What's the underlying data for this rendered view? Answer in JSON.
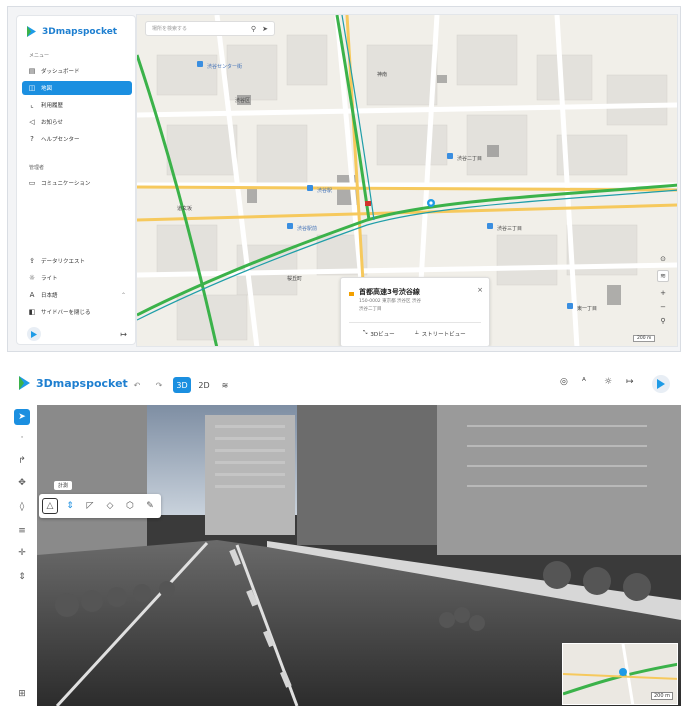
{
  "colors": {
    "brand": "#1e7fd0",
    "active": "#1b8fe0",
    "expressway": "#3bb24a",
    "popup_flag": "#f3a000"
  },
  "app": {
    "name": "3Dmapspocket"
  },
  "sidebar": {
    "section_menu": "メニュー",
    "items": [
      {
        "label": "ダッシュボード",
        "icon": "dashboard-icon"
      },
      {
        "label": "地図",
        "icon": "map-icon",
        "active": true
      },
      {
        "label": "利用履歴",
        "icon": "history-icon"
      },
      {
        "label": "お知らせ",
        "icon": "megaphone-icon"
      },
      {
        "label": "ヘルプセンター",
        "icon": "help-icon"
      }
    ],
    "section_admin": "管理者",
    "admin_items": [
      {
        "label": "コミュニケーション",
        "icon": "chat-icon"
      }
    ],
    "footer_items": [
      {
        "label": "データリクエスト",
        "icon": "upload-icon"
      },
      {
        "label": "ライト",
        "icon": "sun-icon"
      },
      {
        "label": "日本語",
        "icon": "language-icon",
        "has_chevron": true
      },
      {
        "label": "サイドバーを閉じる",
        "icon": "sidebar-icon"
      }
    ]
  },
  "map": {
    "search_placeholder": "場所を検索する",
    "labels": {
      "shibuya_ward": "渋谷区",
      "shibuya_center": "渋谷センター街",
      "shibuya_sta": "渋谷駅",
      "shibuya_sta_b": "渋谷駅前",
      "jinnan": "神南",
      "dogenzaka": "道玄坂",
      "sakuragaoka": "桜丘町",
      "shibuya_2": "渋谷二丁目",
      "shibuya_3": "渋谷三丁目",
      "higashi": "東一丁目"
    },
    "popup": {
      "title": "首都高速3号渋谷線",
      "address": "150-0002 東京都 渋谷区 渋谷",
      "subtitle": "渋谷二丁目",
      "close": "×",
      "btn_3d": "3Dビュー",
      "btn_street": "ストリートビュー"
    },
    "scale": "200 m"
  },
  "viewer": {
    "mode_3d": "3D",
    "mode_2d": "2D",
    "undo": "↶",
    "redo": "↷",
    "tooltip": "計測",
    "minimap_scale": "200 m"
  }
}
